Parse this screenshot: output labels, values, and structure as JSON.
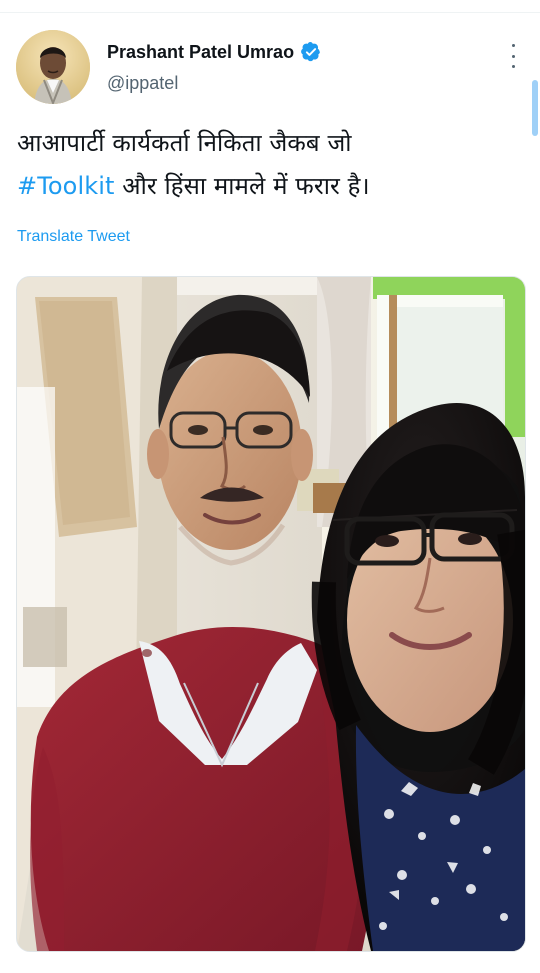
{
  "tweet": {
    "author": {
      "display_name": "Prashant Patel Umrao",
      "handle": "@ippatel",
      "verified": true,
      "avatar_icon": "person-portrait-icon",
      "verified_icon": "verified-badge-icon"
    },
    "text": {
      "line1": "आआपार्टी कार्यकर्ता निकिता जैकब जो",
      "hashtag": "#Toolkit",
      "line2_rest": " और हिंसा मामले में फरार है।"
    },
    "translate_label": "Translate Tweet",
    "media": {
      "type": "photo",
      "description_icon": "selfie-photo-icon"
    },
    "more_icon": "more-vertical-icon"
  },
  "colors": {
    "text": "#0f1419",
    "secondary": "#536471",
    "link": "#1d9bf0",
    "verified": "#1d9bf0",
    "divider": "#eff3f4"
  }
}
